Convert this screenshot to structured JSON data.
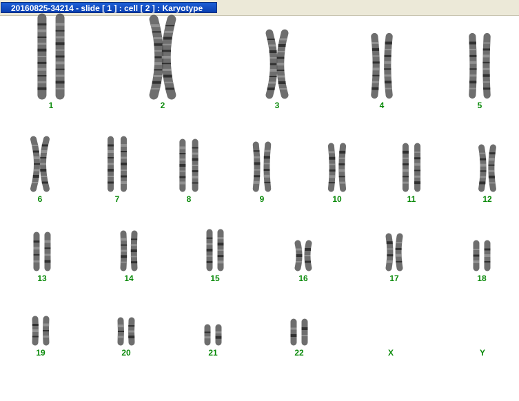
{
  "window": {
    "title": "20160825-34214 - slide [ 1 ] : cell [ 2 ] : Karyotype"
  },
  "colors": {
    "label": "#0a8a0a",
    "title_bg": "#0a3fb0",
    "chromosome": "#555555"
  },
  "karyotype": {
    "pairs": [
      {
        "label": "1"
      },
      {
        "label": "2"
      },
      {
        "label": "3"
      },
      {
        "label": "4"
      },
      {
        "label": "5"
      },
      {
        "label": "6"
      },
      {
        "label": "7"
      },
      {
        "label": "8"
      },
      {
        "label": "9"
      },
      {
        "label": "10"
      },
      {
        "label": "11"
      },
      {
        "label": "12"
      },
      {
        "label": "13"
      },
      {
        "label": "14"
      },
      {
        "label": "15"
      },
      {
        "label": "16"
      },
      {
        "label": "17"
      },
      {
        "label": "18"
      },
      {
        "label": "19"
      },
      {
        "label": "20"
      },
      {
        "label": "21"
      },
      {
        "label": "22"
      },
      {
        "label": "X"
      },
      {
        "label": "Y"
      }
    ]
  }
}
